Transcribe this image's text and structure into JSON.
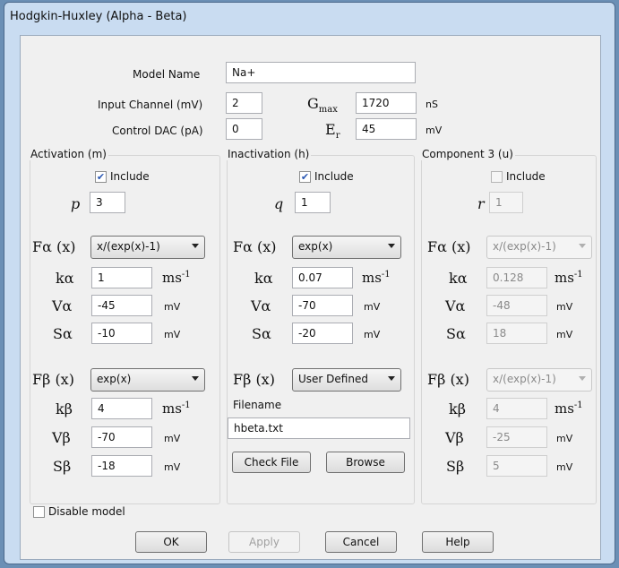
{
  "window": {
    "title": "Hodgkin-Huxley (Alpha - Beta)"
  },
  "top": {
    "model_name_label": "Model Name",
    "model_name_value": "Na+",
    "input_channel_label": "Input Channel (mV)",
    "input_channel_value": "2",
    "control_dac_label": "Control DAC (pA)",
    "control_dac_value": "0",
    "gmax_label": "G",
    "gmax_sub": "max",
    "gmax_value": "1720",
    "gmax_unit": "nS",
    "er_label": "E",
    "er_sub": "r",
    "er_value": "45",
    "er_unit": "mV"
  },
  "activation": {
    "title": "Activation (m)",
    "include_label": "Include",
    "include_checked": true,
    "exp_label": "p",
    "exp_value": "3",
    "f_alpha_label": "Fα (x)",
    "f_alpha_value": "x/(exp(x)-1)",
    "k_alpha_label": "kα",
    "k_alpha_value": "1",
    "k_alpha_unit": "ms",
    "k_alpha_unit_sup": "-1",
    "v_alpha_label": "Vα",
    "v_alpha_value": "-45",
    "v_alpha_unit": "mV",
    "s_alpha_label": "Sα",
    "s_alpha_value": "-10",
    "s_alpha_unit": "mV",
    "f_beta_label": "Fβ (x)",
    "f_beta_value": "exp(x)",
    "k_beta_label": "kβ",
    "k_beta_value": "4",
    "k_beta_unit": "ms",
    "k_beta_unit_sup": "-1",
    "v_beta_label": "Vβ",
    "v_beta_value": "-70",
    "v_beta_unit": "mV",
    "s_beta_label": "Sβ",
    "s_beta_value": "-18",
    "s_beta_unit": "mV"
  },
  "inactivation": {
    "title": "Inactivation (h)",
    "include_label": "Include",
    "include_checked": true,
    "exp_label": "q",
    "exp_value": "1",
    "f_alpha_label": "Fα (x)",
    "f_alpha_value": "exp(x)",
    "k_alpha_label": "kα",
    "k_alpha_value": "0.07",
    "k_alpha_unit": "ms",
    "k_alpha_unit_sup": "-1",
    "v_alpha_label": "Vα",
    "v_alpha_value": "-70",
    "v_alpha_unit": "mV",
    "s_alpha_label": "Sα",
    "s_alpha_value": "-20",
    "s_alpha_unit": "mV",
    "f_beta_label": "Fβ (x)",
    "f_beta_value": "User Defined",
    "filename_label": "Filename",
    "filename_value": "hbeta.txt",
    "check_file_label": "Check File",
    "browse_label": "Browse"
  },
  "component3": {
    "title": "Component 3 (u)",
    "include_label": "Include",
    "include_checked": false,
    "exp_label": "r",
    "exp_value": "1",
    "f_alpha_label": "Fα (x)",
    "f_alpha_value": "x/(exp(x)-1)",
    "k_alpha_label": "kα",
    "k_alpha_value": "0.128",
    "k_alpha_unit": "ms",
    "k_alpha_unit_sup": "-1",
    "v_alpha_label": "Vα",
    "v_alpha_value": "-48",
    "v_alpha_unit": "mV",
    "s_alpha_label": "Sα",
    "s_alpha_value": "18",
    "s_alpha_unit": "mV",
    "f_beta_label": "Fβ (x)",
    "f_beta_value": "x/(exp(x)-1)",
    "k_beta_label": "kβ",
    "k_beta_value": "4",
    "k_beta_unit": "ms",
    "k_beta_unit_sup": "-1",
    "v_beta_label": "Vβ",
    "v_beta_value": "-25",
    "v_beta_unit": "mV",
    "s_beta_label": "Sβ",
    "s_beta_value": "5",
    "s_beta_unit": "mV"
  },
  "footer": {
    "disable_label": "Disable model",
    "disable_checked": false,
    "ok_label": "OK",
    "apply_label": "Apply",
    "cancel_label": "Cancel",
    "help_label": "Help"
  },
  "icons": {
    "checkmark": "check-icon",
    "dropdown": "chevron-down-icon"
  }
}
